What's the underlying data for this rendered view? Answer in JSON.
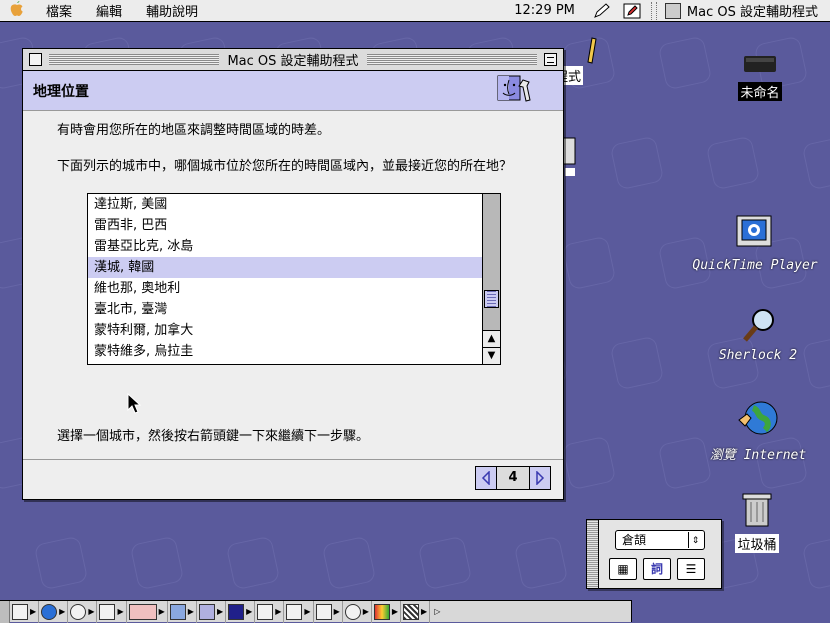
{
  "menubar": {
    "menus": [
      "檔案",
      "編輯",
      "輔助說明"
    ],
    "clock": "12:29 PM",
    "app_name": "Mac OS 設定輔助程式"
  },
  "window": {
    "title": "Mac OS 設定輔助程式",
    "heading": "地理位置",
    "intro": "有時會用您所在的地區來調整時間區域的時差。",
    "question": "下面列示的城市中，哪個城市位於您所在的時間區域內，並最接近您的所在地？",
    "cities": [
      {
        "name": "達拉斯, 美國",
        "selected": false
      },
      {
        "name": "雷西非, 巴西",
        "selected": false
      },
      {
        "name": "雷基亞比克, 冰島",
        "selected": false
      },
      {
        "name": "漢城, 韓國",
        "selected": true
      },
      {
        "name": "維也那, 奧地利",
        "selected": false
      },
      {
        "name": "臺北市, 臺灣",
        "selected": false
      },
      {
        "name": "蒙特利爾, 加拿大",
        "selected": false
      },
      {
        "name": "蒙特維多, 烏拉圭",
        "selected": false
      }
    ],
    "instruction": "選擇一個城市，然後按右箭頭鍵一下來繼續下一步驟。",
    "page_number": "4"
  },
  "desktop": {
    "icons": [
      {
        "label": "未命名"
      },
      {
        "label": "程式"
      },
      {
        "label": "QuickTime Player"
      },
      {
        "label": "Sherlock 2"
      },
      {
        "label": "瀏覽 Internet"
      },
      {
        "label": "垃圾桶"
      }
    ]
  },
  "palette": {
    "select_value": "倉頡",
    "buttons": [
      "▦",
      "詞",
      "☰"
    ]
  },
  "colors": {
    "desktop": "#5a5a9c",
    "accent": "#ccccf2",
    "highlight": "#3a3ab0"
  }
}
